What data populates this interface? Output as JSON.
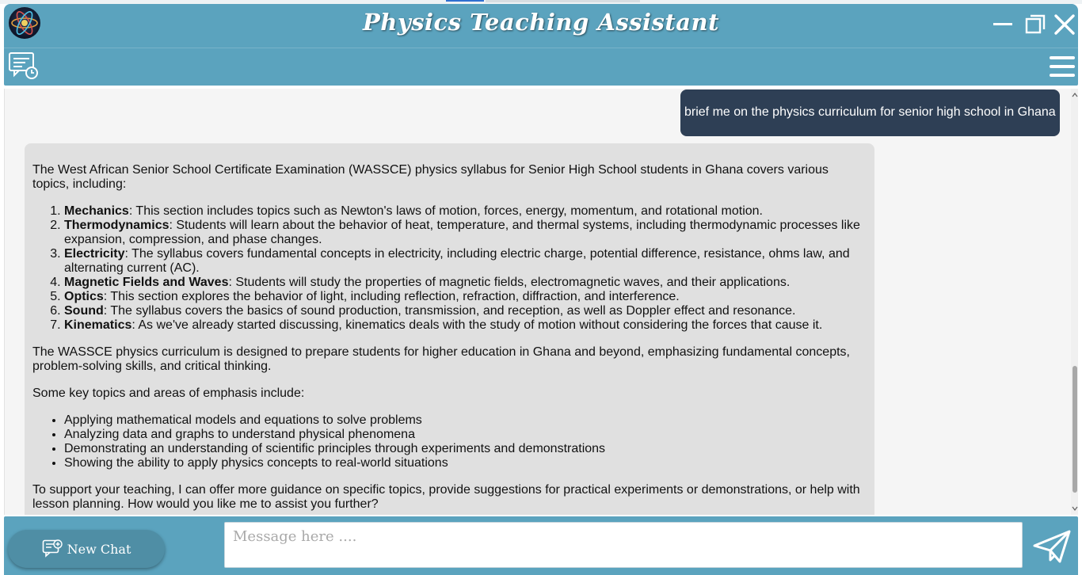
{
  "window": {
    "title": "Physics Teaching Assistant"
  },
  "icons": {
    "logo": "atom-icon",
    "minimize": "minimize-icon",
    "maximize": "restore-icon",
    "close": "close-icon",
    "history": "chat-history-icon",
    "menu": "hamburger-menu-icon",
    "new_chat": "new-chat-icon",
    "send": "send-paper-plane-icon"
  },
  "colors": {
    "header": "#5ba3be",
    "user_bubble": "#2e3f55",
    "assistant_bubble": "#e0e0e0",
    "chat_bg": "#f5f5f5"
  },
  "conversation": {
    "user_message": "brief me on the physics curriculum for senior high school in Ghana",
    "assistant": {
      "intro": "The West African Senior School Certificate Examination (WASSCE) physics syllabus for Senior High School students in Ghana covers various topics, including:",
      "topics": [
        {
          "title": "Mechanics",
          "desc": ": This section includes topics such as Newton's laws of motion, forces, energy, momentum, and rotational motion."
        },
        {
          "title": "Thermodynamics",
          "desc": ": Students will learn about the behavior of heat, temperature, and thermal systems, including thermodynamic processes like expansion, compression, and phase changes."
        },
        {
          "title": "Electricity",
          "desc": ": The syllabus covers fundamental concepts in electricity, including electric charge, potential difference, resistance, ohms law, and alternating current (AC)."
        },
        {
          "title": "Magnetic Fields and Waves",
          "desc": ": Students will study the properties of magnetic fields, electromagnetic waves, and their applications."
        },
        {
          "title": "Optics",
          "desc": ": This section explores the behavior of light, including reflection, refraction, diffraction, and interference."
        },
        {
          "title": "Sound",
          "desc": ": The syllabus covers the basics of sound production, transmission, and reception, as well as Doppler effect and resonance."
        },
        {
          "title": "Kinematics",
          "desc": ": As we've already started discussing, kinematics deals with the study of motion without considering the forces that cause it."
        }
      ],
      "para2": "The WASSCE physics curriculum is designed to prepare students for higher education in Ghana and beyond, emphasizing fundamental concepts, problem-solving skills, and critical thinking.",
      "para3": "Some key topics and areas of emphasis include:",
      "bullets": [
        "Applying mathematical models and equations to solve problems",
        "Analyzing data and graphs to understand physical phenomena",
        "Demonstrating an understanding of scientific principles through experiments and demonstrations",
        "Showing the ability to apply physics concepts to real-world situations"
      ],
      "closing": "To support your teaching, I can offer more guidance on specific topics, provide suggestions for practical experiments or demonstrations, or help with lesson planning. How would you like me to assist you further?"
    }
  },
  "footer": {
    "new_chat_label": "New Chat",
    "input_placeholder": "Message here ....",
    "input_value": ""
  }
}
